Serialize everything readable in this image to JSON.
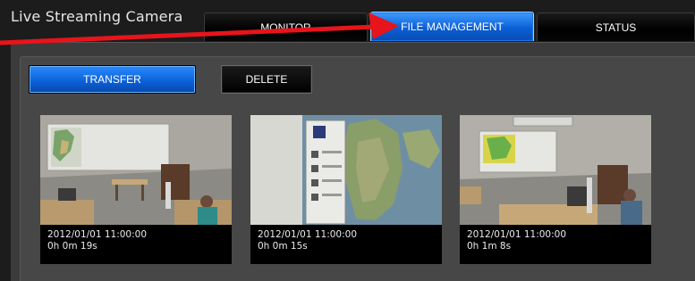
{
  "app": {
    "title": "Live Streaming Camera"
  },
  "tabs": [
    {
      "label": "MONITOR",
      "active": false
    },
    {
      "label": "FILE MANAGEMENT",
      "active": true
    },
    {
      "label": "STATUS",
      "active": false
    }
  ],
  "toolbar": {
    "transfer_label": "TRANSFER",
    "delete_label": "DELETE"
  },
  "recordings": [
    {
      "date": "2012/01/01 11:00:00",
      "duration": "0h 0m 19s"
    },
    {
      "date": "2012/01/01 11:00:00",
      "duration": "0h 0m 15s"
    },
    {
      "date": "2012/01/01 11:00:00",
      "duration": "0h 1m 8s"
    }
  ],
  "colors": {
    "accent_blue": "#0a5fd6",
    "annotation_arrow": "#e8141b",
    "background": "#1c1c1c"
  },
  "icons": {
    "annotation": "red-arrow-icon"
  }
}
